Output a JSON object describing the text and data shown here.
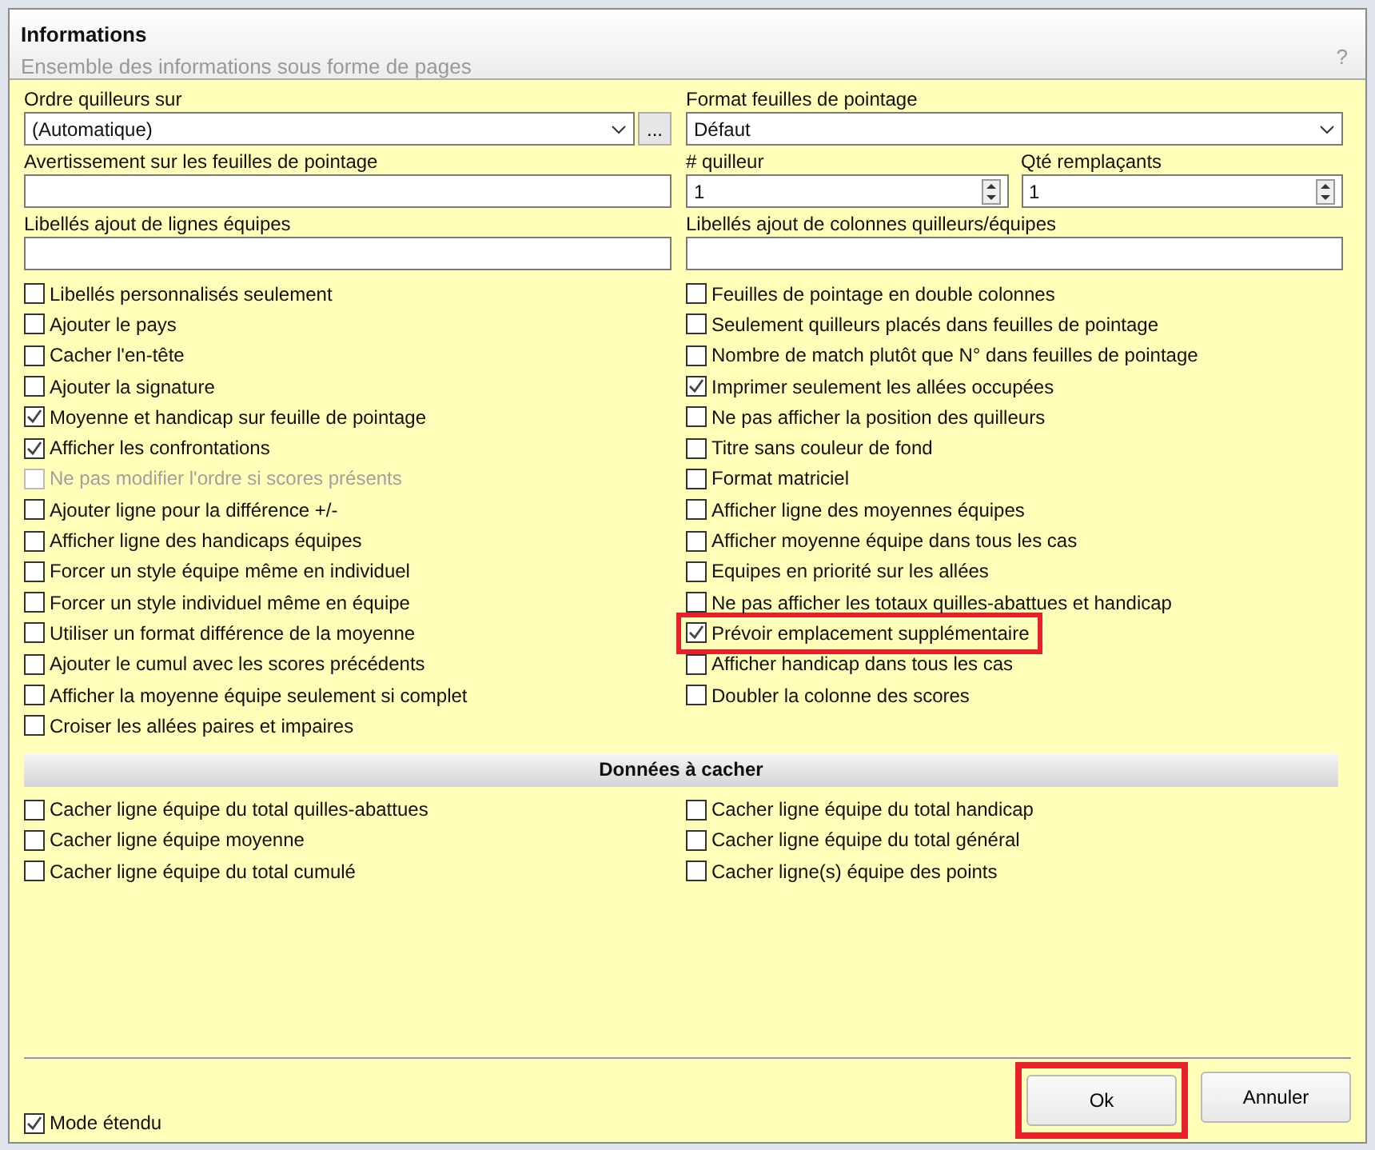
{
  "dialog": {
    "title": "Informations",
    "subtitle": "Ensemble des informations sous forme de pages",
    "help": "?"
  },
  "fields": {
    "ordre": {
      "label": "Ordre quilleurs sur",
      "value": "(Automatique)",
      "button": "..."
    },
    "format": {
      "label": "Format feuilles de pointage",
      "value": "Défaut"
    },
    "avertissement": {
      "label": "Avertissement sur les feuilles de pointage"
    },
    "quilleur": {
      "label": "# quilleur",
      "value": "1"
    },
    "remplacants": {
      "label": "Qté remplaçants",
      "value": "1"
    },
    "lignes": {
      "label": "Libellés ajout de lignes équipes"
    },
    "colonnes": {
      "label": "Libellés ajout de colonnes quilleurs/équipes"
    }
  },
  "options_left": [
    {
      "label": "Libellés personnalisés seulement",
      "checked": false,
      "disabled": false
    },
    {
      "label": "Ajouter le pays",
      "checked": false,
      "disabled": false
    },
    {
      "label": "Cacher l'en-tête",
      "checked": false,
      "disabled": false
    },
    {
      "label": "Ajouter la signature",
      "checked": false,
      "disabled": false
    },
    {
      "label": "Moyenne et handicap sur feuille de pointage",
      "checked": true,
      "disabled": false
    },
    {
      "label": "Afficher les confrontations",
      "checked": true,
      "disabled": false
    },
    {
      "label": "Ne pas modifier l'ordre si scores présents",
      "checked": false,
      "disabled": true
    },
    {
      "label": "Ajouter ligne pour la différence +/-",
      "checked": false,
      "disabled": false
    },
    {
      "label": "Afficher ligne des handicaps équipes",
      "checked": false,
      "disabled": false
    },
    {
      "label": "Forcer un style équipe même en individuel",
      "checked": false,
      "disabled": false
    },
    {
      "label": "Forcer un style individuel même en équipe",
      "checked": false,
      "disabled": false
    },
    {
      "label": "Utiliser un format différence de la moyenne",
      "checked": false,
      "disabled": false
    },
    {
      "label": "Ajouter le cumul avec les scores précédents",
      "checked": false,
      "disabled": false
    },
    {
      "label": "Afficher la moyenne équipe seulement si complet",
      "checked": false,
      "disabled": false
    },
    {
      "label": "Croiser les allées paires et impaires",
      "checked": false,
      "disabled": false
    }
  ],
  "options_right": [
    {
      "label": "Feuilles de pointage en double colonnes",
      "checked": false,
      "highlighted": false
    },
    {
      "label": "Seulement quilleurs placés dans feuilles de pointage",
      "checked": false,
      "highlighted": false
    },
    {
      "label": "Nombre de match plutôt que N° dans feuilles de pointage",
      "checked": false,
      "highlighted": false
    },
    {
      "label": "Imprimer seulement les allées occupées",
      "checked": true,
      "highlighted": false
    },
    {
      "label": "Ne pas afficher la position des quilleurs",
      "checked": false,
      "highlighted": false
    },
    {
      "label": "Titre sans couleur de fond",
      "checked": false,
      "highlighted": false
    },
    {
      "label": "Format matriciel",
      "checked": false,
      "highlighted": false
    },
    {
      "label": "Afficher ligne des moyennes équipes",
      "checked": false,
      "highlighted": false
    },
    {
      "label": "Afficher moyenne équipe dans tous les cas",
      "checked": false,
      "highlighted": false
    },
    {
      "label": "Equipes en priorité sur les allées",
      "checked": false,
      "highlighted": false
    },
    {
      "label": "Ne pas afficher les totaux quilles-abattues et handicap",
      "checked": false,
      "highlighted": false
    },
    {
      "label": "Prévoir emplacement supplémentaire",
      "checked": true,
      "highlighted": true
    },
    {
      "label": "Afficher handicap dans tous les cas",
      "checked": false,
      "highlighted": false
    },
    {
      "label": "Doubler la colonne des scores",
      "checked": false,
      "highlighted": false
    }
  ],
  "hide_section": {
    "title": "Données à cacher",
    "options": [
      {
        "label": "Cacher ligne équipe du total quilles-abattues",
        "checked": false
      },
      {
        "label": "Cacher ligne équipe du total handicap",
        "checked": false
      },
      {
        "label": "Cacher ligne équipe moyenne",
        "checked": false
      },
      {
        "label": "Cacher ligne équipe du total général",
        "checked": false
      },
      {
        "label": "Cacher ligne équipe du total cumulé",
        "checked": false
      },
      {
        "label": "Cacher ligne(s) équipe des points",
        "checked": false
      }
    ]
  },
  "mode_etendu": {
    "label": "Mode étendu",
    "checked": true
  },
  "buttons": [
    {
      "label": "Ok",
      "highlighted": true
    },
    {
      "label": "Annuler",
      "highlighted": false
    }
  ]
}
